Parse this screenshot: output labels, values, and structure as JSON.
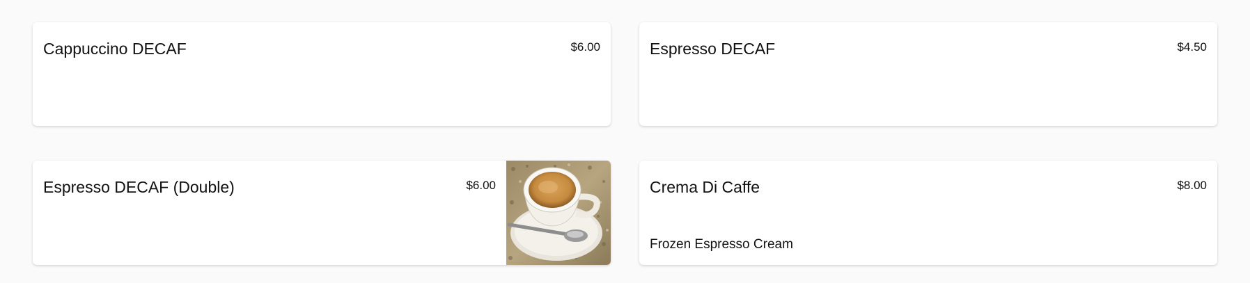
{
  "menu_items": [
    {
      "name": "Cappuccino DECAF",
      "price": "$6.00"
    },
    {
      "name": "Espresso DECAF",
      "price": "$4.50"
    },
    {
      "name": "Espresso DECAF (Double)",
      "price": "$6.00",
      "image": "coffee-cup-photo"
    },
    {
      "name": "Crema Di Caffe",
      "price": "$8.00",
      "description": "Frozen Espresso Cream"
    }
  ],
  "colors": {
    "page_background": "#fafafa",
    "card_background": "#ffffff",
    "text": "#111111"
  }
}
